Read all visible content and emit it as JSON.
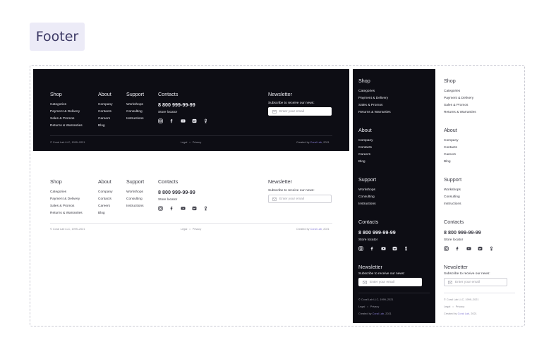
{
  "page_label": "Footer",
  "columns": {
    "shop": {
      "title": "Shop",
      "items": [
        "Categories",
        "Payment & Delivery",
        "Sales & Promos",
        "Returns & Warranties"
      ]
    },
    "about": {
      "title": "About",
      "items": [
        "Company",
        "Contacts",
        "Careers",
        "Blog"
      ]
    },
    "support": {
      "title": "Support",
      "items": [
        "Workshops",
        "Consulting",
        "Instructions"
      ]
    }
  },
  "contacts": {
    "title": "Contacts",
    "phone": "8 800 999-99-99",
    "store_locator": "Store locator"
  },
  "socials": [
    "instagram-icon",
    "facebook-icon",
    "youtube-icon",
    "vk-icon",
    "odnoklassniki-icon"
  ],
  "newsletter": {
    "title": "Newsletter",
    "subtitle": "Subscribe to receive our news:",
    "placeholder": "Enter your email"
  },
  "bottom": {
    "copyright": "© Coral Lab LLC, 1999–2021",
    "legal": "Legal",
    "separator": "•",
    "privacy": "Privacy",
    "created_by": "Created by",
    "creator": "Coral Lab",
    "year": ", 2021"
  },
  "colors": {
    "dark_bg": "#0d0d14",
    "accent": "#8a7fd6",
    "tag_bg": "#ecebf7"
  }
}
